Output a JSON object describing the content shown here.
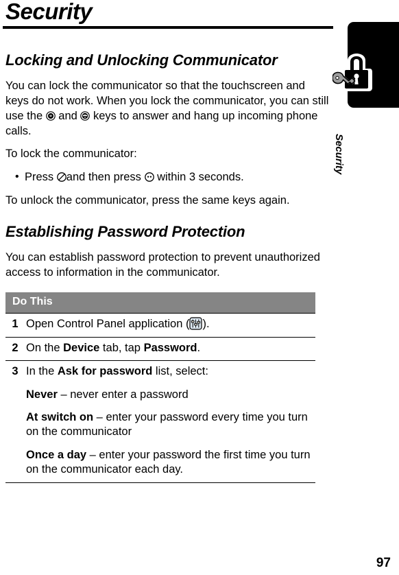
{
  "page": {
    "title": "Security",
    "number": "97",
    "side_tab_label": "Security",
    "side_tab_icon": "padlock-and-key-icon"
  },
  "sections": [
    {
      "heading": "Locking and Unlocking Communicator",
      "paragraphs": [
        {
          "parts": [
            {
              "type": "text",
              "value": "You can lock the communicator so that the touchscreen and keys do not work. When you lock the communicator, you can still use the "
            },
            {
              "type": "icon",
              "name": "send-key-icon"
            },
            {
              "type": "text",
              "value": " and "
            },
            {
              "type": "icon",
              "name": "end-key-icon"
            },
            {
              "type": "text",
              "value": " keys to answer and hang up incoming phone calls."
            }
          ]
        },
        {
          "parts": [
            {
              "type": "text",
              "value": "To lock the communicator:"
            }
          ]
        }
      ],
      "bullets": [
        {
          "parts": [
            {
              "type": "text",
              "value": "Press "
            },
            {
              "type": "icon",
              "name": "power-slash-key-icon"
            },
            {
              "type": "text",
              "value": "and then press "
            },
            {
              "type": "icon",
              "name": "dot-key-icon"
            },
            {
              "type": "text",
              "value": " within 3 seconds."
            }
          ]
        }
      ],
      "closing": "To unlock the communicator, press the same keys again."
    },
    {
      "heading": "Establishing Password Protection",
      "intro": "You can establish password protection to prevent unauthorized access to information in the communicator."
    }
  ],
  "do_table": {
    "header": "Do This",
    "rows": [
      {
        "num": "1",
        "lines": [
          {
            "parts": [
              {
                "type": "text",
                "value": "Open Control Panel application ("
              },
              {
                "type": "icon",
                "name": "control-panel-sliders-icon"
              },
              {
                "type": "text",
                "value": ")."
              }
            ]
          }
        ]
      },
      {
        "num": "2",
        "lines": [
          {
            "parts": [
              {
                "type": "text",
                "value": "On the "
              },
              {
                "type": "bold",
                "value": "Device"
              },
              {
                "type": "text",
                "value": " tab, tap "
              },
              {
                "type": "bold",
                "value": "Password"
              },
              {
                "type": "text",
                "value": "."
              }
            ]
          }
        ]
      },
      {
        "num": "3",
        "lines": [
          {
            "parts": [
              {
                "type": "text",
                "value": "In the "
              },
              {
                "type": "bold",
                "value": "Ask for password"
              },
              {
                "type": "text",
                "value": " list, select:"
              }
            ]
          },
          {
            "sub": true,
            "parts": [
              {
                "type": "bold",
                "value": "Never"
              },
              {
                "type": "text",
                "value": " – never enter a password"
              }
            ]
          },
          {
            "sub": true,
            "parts": [
              {
                "type": "bold",
                "value": "At switch on"
              },
              {
                "type": "text",
                "value": " – enter your password every time you turn on the communicator"
              }
            ]
          },
          {
            "sub": true,
            "parts": [
              {
                "type": "bold",
                "value": "Once a day"
              },
              {
                "type": "text",
                "value": " – enter your password the first time you turn on the communicator each day."
              }
            ]
          }
        ]
      }
    ]
  },
  "colors": {
    "table_header_bg": "#858585",
    "table_header_text": "#ffffff",
    "rule": "#000000",
    "tab": "#000000"
  }
}
